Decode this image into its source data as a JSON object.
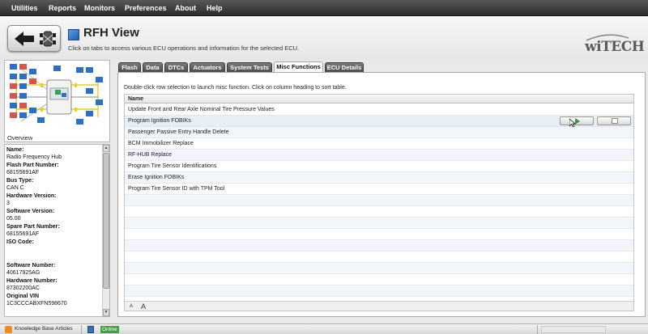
{
  "menu": [
    "Utilities",
    "Reports",
    "Monitors",
    "Preferences",
    "About",
    "Help"
  ],
  "header": {
    "title": "RFH View",
    "subtitle": "Click on tabs to access various ECU operations and information for the selected ECU.",
    "logo": "wiTECH"
  },
  "left_panel": {
    "diagram_label": "Overview",
    "info": [
      {
        "label": "Name:",
        "value": "Radio Frequency Hub"
      },
      {
        "label": "Flash Part Number:",
        "value": "68155691AF"
      },
      {
        "label": "Bus Type:",
        "value": "CAN C"
      },
      {
        "label": "Hardware Version:",
        "value": "3"
      },
      {
        "label": "Software Version:",
        "value": "05.00"
      },
      {
        "label": "Spare Part Number:",
        "value": "68155691AF"
      },
      {
        "label": "ISO Code:",
        "value": ""
      },
      {
        "label": "Software Number:",
        "value": "40617925AG"
      },
      {
        "label": "Hardware Number:",
        "value": "87302200AC"
      },
      {
        "label": "Original VIN",
        "value": "1C3CCCABXFN598670"
      }
    ]
  },
  "tabs": [
    {
      "label": "Flash",
      "active": false
    },
    {
      "label": "Data",
      "active": false
    },
    {
      "label": "DTCs",
      "active": false
    },
    {
      "label": "Actuators",
      "active": false
    },
    {
      "label": "System Tests",
      "active": false
    },
    {
      "label": "Misc Functions",
      "active": true
    },
    {
      "label": "ECU Details",
      "active": false
    }
  ],
  "content": {
    "instruction": "Double-click row selection to launch misc function.  Click on column heading to sort table.",
    "column_header": "Name",
    "rows": [
      "Update Front and Rear Axle Nominal Tire Pressure Values",
      "Program Ignition FOBIKs",
      "Passenger Passive Entry Handle Delete",
      "BCM Immobilizer Replace",
      "RF-HUB Replace",
      "Program Tire Sensor Identifications",
      "Erase Ignition FOBIKs",
      "Program Tire Sensor ID with TPM Tool"
    ],
    "selected_row": 1,
    "font_small": "A",
    "font_large": "A"
  },
  "statusbar": {
    "kb_link": "Knowledge Base Articles",
    "online": "Online"
  },
  "colors": {
    "menubar": "#3a3a3a",
    "accent_blue": "#2a6fc9",
    "online_green": "#3fa33f"
  },
  "icons": [
    "back-arrow-icon",
    "car-topology-icon",
    "run-icon",
    "document-icon",
    "rss-icon",
    "network-icon"
  ]
}
